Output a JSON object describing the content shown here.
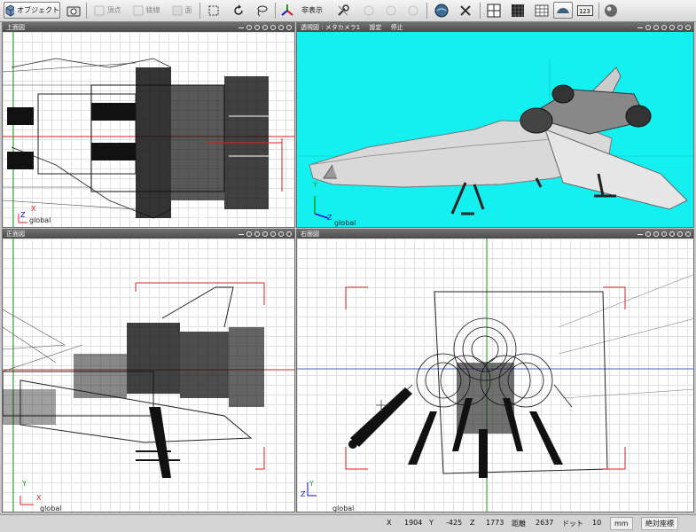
{
  "toolbar": {
    "object_label": "オブジェクト",
    "vertex_label": "頂点",
    "edge_label": "稜線",
    "face_label": "面",
    "hide_label": "非表示"
  },
  "panels": {
    "top": {
      "title": "上面図"
    },
    "perspective": {
      "title": "透視図 : メタカメラ1",
      "settings": "設定",
      "stop": "停止"
    },
    "front": {
      "title": "正面図"
    },
    "right": {
      "title": "右面図"
    }
  },
  "axes": {
    "x": "X",
    "y": "Y",
    "z": "Z",
    "global": "global"
  },
  "status": {
    "x_label": "X",
    "x_value": "1904",
    "y_label": "Y",
    "y_value": "-425",
    "z_label": "Z",
    "z_value": "1773",
    "distance_label": "距離",
    "distance_value": "2637",
    "dot_label": "ドット",
    "dot_value": "10",
    "unit": "mm",
    "mode": "絶対座標"
  }
}
